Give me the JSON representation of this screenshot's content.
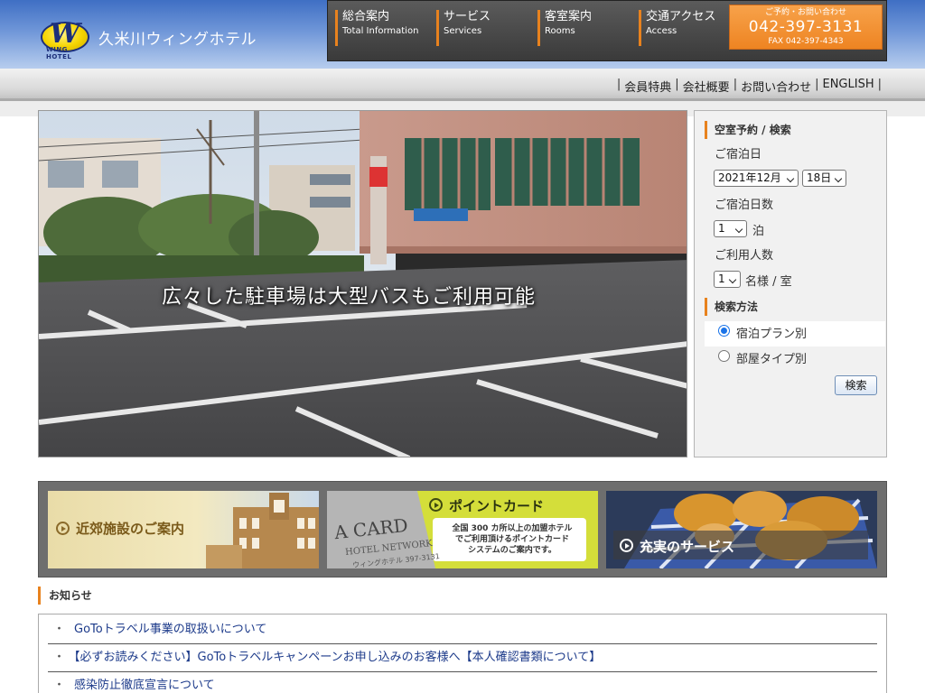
{
  "header": {
    "logo_text": "久米川ウィングホテル",
    "logo_emblem_letter": "W",
    "logo_emblem_sub": "WING HOTEL"
  },
  "global_nav": [
    {
      "jp": "総合案内",
      "en": "Total Information"
    },
    {
      "jp": "サービス",
      "en": "Services"
    },
    {
      "jp": "客室案内",
      "en": "Rooms"
    },
    {
      "jp": "交通アクセス",
      "en": "Access"
    }
  ],
  "contact": {
    "label": "ご予約・お問い合わせ",
    "tel": "042-397-3131",
    "fax": "FAX 042-397-4343"
  },
  "sub_nav": [
    "会員特典",
    "会社概要",
    "お問い合わせ",
    "ENGLISH"
  ],
  "hero": {
    "caption": "広々した駐車場は大型バスもご利用可能"
  },
  "booking": {
    "section_title": "空室予約 / 検索",
    "date_label": "ご宿泊日",
    "year_month": "2021年12月",
    "day": "18日",
    "nights_label": "ご宿泊日数",
    "nights_value": "1",
    "nights_unit": "泊",
    "people_label": "ご利用人数",
    "people_value": "1",
    "people_unit": "名様 / 室",
    "method_title": "検索方法",
    "method_options": [
      "宿泊プラン別",
      "部屋タイプ別"
    ],
    "method_selected": 0,
    "search_button": "検索"
  },
  "banners": [
    {
      "title": "近郊施設のご案内"
    },
    {
      "title": "ポイントカード",
      "desc": "全国 300 カ所以上の加盟ホテル\nでご利用頂けるポイントカード\nシステムのご案内です。",
      "card_text": "A CARD",
      "card_sub": "HOTEL NETWORK",
      "card_tel": "ウィングホテル 397-3131"
    },
    {
      "title": "充実のサービス"
    }
  ],
  "news": {
    "title": "お知らせ",
    "items": [
      "GoToトラベル事業の取扱いについて",
      "【必ずお読みください】GoToトラベルキャンペーンお申し込みのお客様へ【本人確認書類について】",
      "感染防止徹底宣言について"
    ]
  },
  "colors": {
    "accent": "#e8821e",
    "header_blue": "#5a86d0",
    "nav_dark": "#444444",
    "link_blue": "#1c3a8a"
  }
}
